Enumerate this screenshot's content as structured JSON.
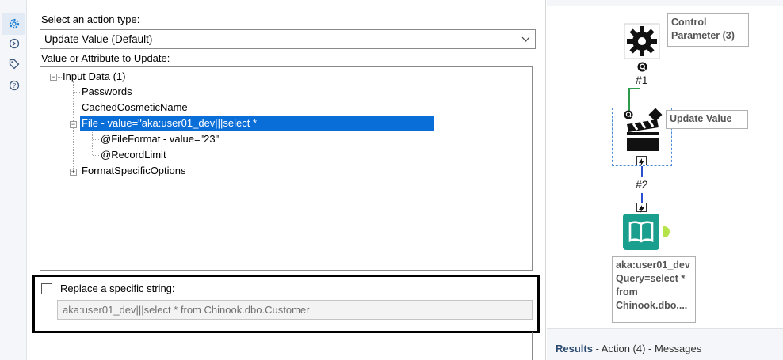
{
  "config": {
    "action_type_label": "Select an action type:",
    "action_type_value": "Update Value (Default)",
    "value_attr_label": "Value or Attribute to Update:",
    "tree": {
      "root": "Input Data (1)",
      "passwords": "Passwords",
      "cached": "CachedCosmeticName",
      "file": "File - value=\"aka:user01_dev|||select *",
      "fileformat": "@FileFormat - value=\"23\"",
      "recordlimit": "@RecordLimit",
      "formatopts": "FormatSpecificOptions"
    },
    "replace_label": "Replace a specific string:",
    "replace_value": "aka:user01_dev|||select * from Chinook.dbo.Customer",
    "replace_checked": false
  },
  "canvas": {
    "control_param_label": [
      "Control",
      "Parameter (3)"
    ],
    "connection1": "#1",
    "update_value_label": "Update Value",
    "connection2": "#2",
    "input_label": [
      "aka:user01_dev",
      "Query=select *",
      "from",
      "Chinook.dbo...."
    ]
  },
  "results": {
    "title": "Results",
    "rest": " - Action (4) - Messages"
  },
  "colors": {
    "selection": "#0a6ed9",
    "input_tool": "#1a9f8f",
    "connector_green": "#2e9b4c",
    "connector_blue": "#2a4fd0"
  }
}
